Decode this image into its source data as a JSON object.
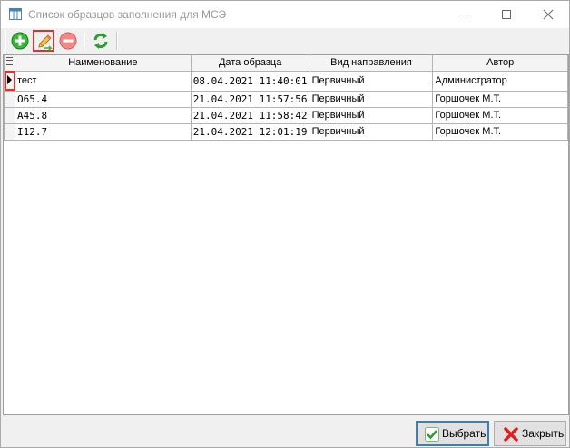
{
  "window": {
    "title": "Список образцов заполнения для МСЭ",
    "icon": "table-icon"
  },
  "toolbar": {
    "add_icon": "plus-circle-icon",
    "edit_icon": "pencil-icon",
    "delete_icon": "minus-circle-icon",
    "refresh_icon": "refresh-icon"
  },
  "table": {
    "columns": [
      "Наименование",
      "Дата образца",
      "Вид направления",
      "Автор"
    ],
    "rows": [
      {
        "name": "тест",
        "date": "08.04.2021 11:40:01",
        "type": "Первичный",
        "author": "Администратор"
      },
      {
        "name": "O65.4",
        "date": "21.04.2021 11:57:56",
        "type": "Первичный",
        "author": "Горшочек М.Т."
      },
      {
        "name": "A45.8",
        "date": "21.04.2021 11:58:42",
        "type": "Первичный",
        "author": "Горшочек М.Т."
      },
      {
        "name": "I12.7",
        "date": "21.04.2021 12:01:19",
        "type": "Первичный",
        "author": "Горшочек М.Т."
      }
    ]
  },
  "buttons": {
    "select_label": "Выбрать",
    "close_label": "Закрыть"
  },
  "colors": {
    "highlight": "#e03030",
    "add_green": "#3cb43c",
    "delete_red": "#e04848"
  }
}
